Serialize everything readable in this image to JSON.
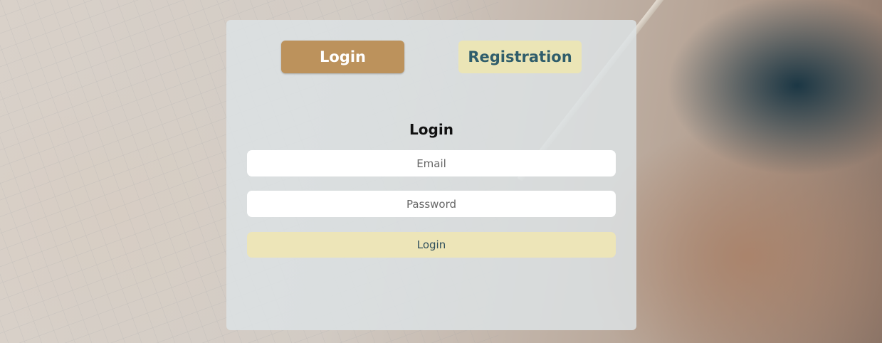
{
  "tabs": {
    "login_label": "Login",
    "registration_label": "Registration"
  },
  "form": {
    "title": "Login",
    "email_placeholder": "Email",
    "password_placeholder": "Password",
    "submit_label": "Login"
  },
  "colors": {
    "active_tab": "#bc925c",
    "inactive_tab": "#ebe5b6",
    "inactive_tab_text": "#2f5d6b",
    "submit_button": "#ede5b8",
    "panel": "#dce2e4"
  }
}
